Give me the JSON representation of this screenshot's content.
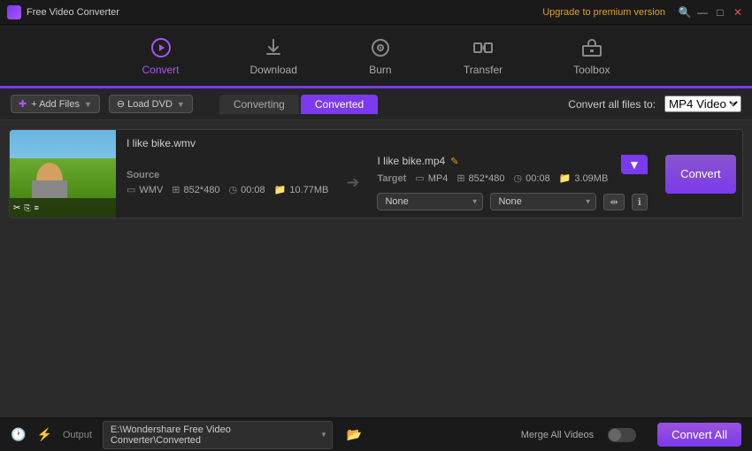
{
  "app": {
    "title": "Free Video Converter",
    "upgrade_text": "Upgrade to premium version"
  },
  "titlebar": {
    "search_icon": "🔍",
    "minimize_icon": "—",
    "maximize_icon": "□",
    "close_icon": "✕"
  },
  "nav": {
    "items": [
      {
        "id": "convert",
        "label": "Convert",
        "active": true
      },
      {
        "id": "download",
        "label": "Download",
        "active": false
      },
      {
        "id": "burn",
        "label": "Burn",
        "active": false
      },
      {
        "id": "transfer",
        "label": "Transfer",
        "active": false
      },
      {
        "id": "toolbox",
        "label": "Toolbox",
        "active": false
      }
    ]
  },
  "toolbar": {
    "add_files_label": "+ Add Files",
    "load_dvd_label": "⊖ Load DVD"
  },
  "tabs": {
    "converting_label": "Converting",
    "converted_label": "Converted"
  },
  "convert_all": {
    "label": "Convert all files to:",
    "format": "MP4 Video"
  },
  "file_item": {
    "source_filename": "I like bike.wmv",
    "target_filename": "I like bike.mp4",
    "source": {
      "label": "Source",
      "format": "WMV",
      "resolution": "852*480",
      "duration": "00:08",
      "size": "10.77MB"
    },
    "target": {
      "label": "Target",
      "format": "MP4",
      "resolution": "852*480",
      "duration": "00:08",
      "size": "3.09MB"
    },
    "effect1": "None",
    "effect2": "None",
    "convert_btn": "Convert"
  },
  "statusbar": {
    "output_label": "Output",
    "output_path": "E:\\Wondershare Free Video Converter\\Converted",
    "merge_label": "Merge All Videos",
    "convert_all_label": "Convert All"
  }
}
